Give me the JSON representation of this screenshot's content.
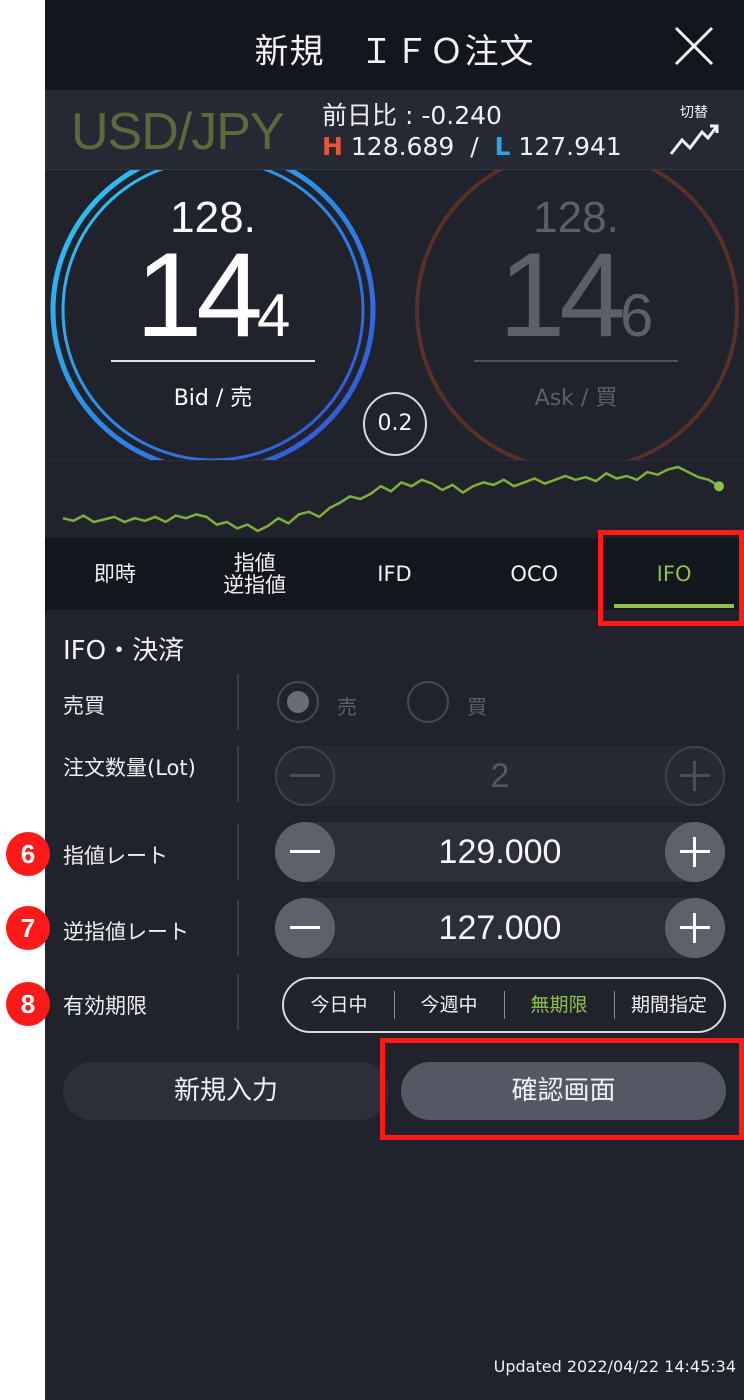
{
  "header": {
    "title": "新規　ＩＦＯ注文"
  },
  "pair": {
    "name": "USD/JPY",
    "change_label": "前日比 : -0.240",
    "high_mark": "H",
    "high_value": "128.689",
    "separator": "/",
    "low_mark": "L",
    "low_value": "127.941",
    "switch_label": "切替"
  },
  "prices": {
    "bid": {
      "prefix": "128.",
      "main": "14",
      "sub": "4",
      "label": "Bid / 売"
    },
    "ask": {
      "prefix": "128.",
      "main": "14",
      "sub": "6",
      "label": "Ask / 買"
    },
    "spread": "0.2"
  },
  "sparkline": {
    "values": [
      30,
      28,
      32,
      27,
      29,
      31,
      27,
      30,
      28,
      31,
      27,
      32,
      30,
      33,
      31,
      25,
      27,
      22,
      25,
      20,
      24,
      30,
      26,
      33,
      35,
      31,
      38,
      42,
      47,
      45,
      49,
      55,
      51,
      58,
      55,
      60,
      57,
      52,
      56,
      50,
      55,
      58,
      56,
      60,
      55,
      58,
      61,
      57,
      60,
      63,
      60,
      62,
      59,
      65,
      61,
      63,
      60,
      66,
      64,
      68,
      70,
      66,
      62,
      60,
      55
    ]
  },
  "tabs": [
    {
      "label": "即時",
      "active": false
    },
    {
      "label": "指値\n逆指値",
      "active": false
    },
    {
      "label": "IFD",
      "active": false
    },
    {
      "label": "OCO",
      "active": false
    },
    {
      "label": "IFO",
      "active": true
    }
  ],
  "form": {
    "section_title": "IFO・決済",
    "side_label": "売買",
    "sell_label": "売",
    "buy_label": "買",
    "lot_label": "注文数量(Lot)",
    "lot_value": "2",
    "limit_label": "指値レート",
    "limit_value": "129.000",
    "stop_label": "逆指値レート",
    "stop_value": "127.000",
    "expiry_label": "有効期限",
    "expiry_options": [
      "今日中",
      "今週中",
      "無期限",
      "期間指定"
    ]
  },
  "buttons": {
    "new_input": "新規入力",
    "confirm": "確認画面"
  },
  "footer": {
    "updated": "Updated  2022/04/22 14:45:34"
  },
  "annotations": {
    "step6": "6",
    "step7": "7",
    "step8": "8"
  },
  "colors": {
    "accent_green": "#8fc04b",
    "high_red": "#e8563a",
    "low_blue": "#2aa4ea",
    "annotation_red": "#ff1a1a",
    "background": "#20232c"
  }
}
